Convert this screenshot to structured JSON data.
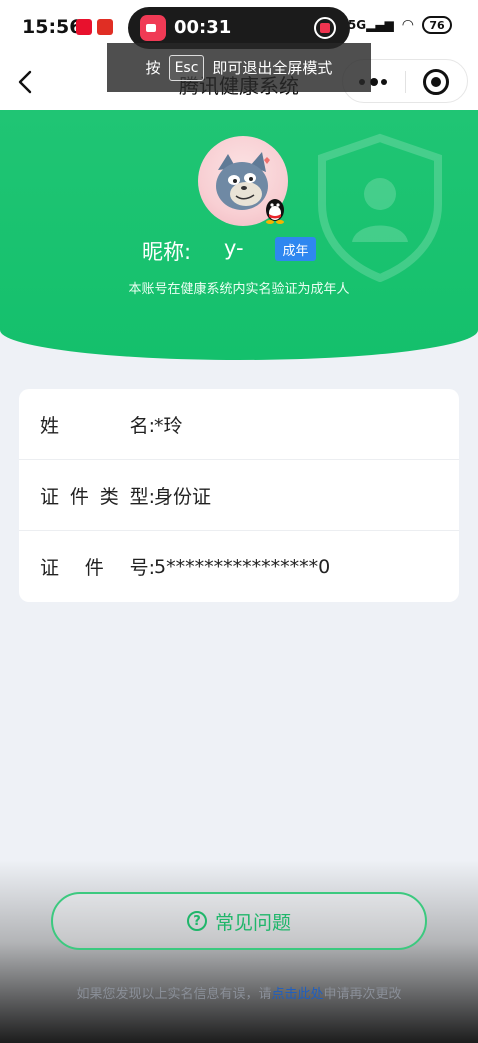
{
  "status_bar": {
    "time": "15:56",
    "signal": "5G",
    "battery": "76"
  },
  "recording": {
    "elapsed": "00:31"
  },
  "esc_tip": {
    "prefix": "按",
    "key": "Esc",
    "suffix": "即可退出全屏模式"
  },
  "nav": {
    "title": "腾讯健康系统"
  },
  "profile": {
    "nickname_label": "昵称:",
    "nickname": "y-",
    "age_badge": "成年",
    "verify_note": "本账号在健康系统内实名验证为成年人"
  },
  "info_rows": [
    {
      "label": [
        "姓",
        "名:"
      ],
      "value": "*玲"
    },
    {
      "label": [
        "证",
        "件",
        "类",
        "型:"
      ],
      "value": "身份证"
    },
    {
      "label": [
        "证",
        "件",
        "号:"
      ],
      "value": "5****************0"
    }
  ],
  "faq": {
    "label": "常见问题",
    "help_icon": "?"
  },
  "footer": {
    "prefix": "如果您发现以上实名信息有误，请",
    "link": "点击此处",
    "suffix": "申请再次更改"
  },
  "colors": {
    "brand_green": "#14c06c",
    "badge_blue": "#2f87f0",
    "link_blue": "#1f5fbf"
  }
}
